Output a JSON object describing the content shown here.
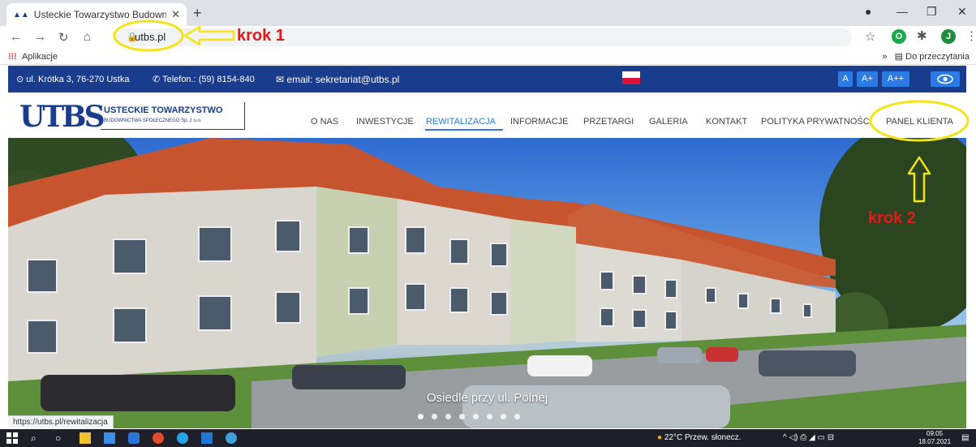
{
  "browser": {
    "tab_title": "Usteckie Towarzystwo Budownict",
    "new_tab": "+",
    "url": "utbs.pl",
    "bookmarks_apps": "Aplikacje",
    "bookmarks_overflow": "»",
    "reading_list": "Do przeczytania",
    "profile_initial": "J",
    "status_url": "https://utbs.pl/rewitalizacja"
  },
  "site": {
    "address": "ul. Krótka 3, 76-270 Ustka",
    "phone": "Telefon.: (59) 8154-840",
    "email_label": "email:",
    "email": "sekretariat@utbs.pl",
    "font_sizes": [
      "A",
      "A+",
      "A++"
    ],
    "logo_mark": "UTBS",
    "logo_name": "USTECKIE TOWARZYSTWO",
    "logo_sub": "BUDOWNICTWA SPOŁECZNEGO Sp. z o.o.",
    "nav": [
      "O NAS",
      "INWESTYCJE",
      "REWITALIZACJA",
      "INFORMACJE",
      "PRZETARGI",
      "GALERIA",
      "KONTAKT",
      "POLITYKA PRYWATNOŚCI",
      "PANEL KLIENTA"
    ],
    "active_nav": "REWITALIZACJA",
    "hero_caption": "Osiedle przy ul. Polnej",
    "slide_count": 8,
    "active_slide": 0
  },
  "annotations": {
    "step1": "krok 1",
    "step2": "krok 2"
  },
  "taskbar": {
    "weather": "22°C  Przew. słonecz.",
    "time": "09:05",
    "date": "18.07.2021"
  },
  "colors": {
    "brand_blue": "#1a3c8c",
    "accent_blue": "#2c7be5",
    "annotation_red": "#e31919",
    "annotation_yellow": "#f5e31a"
  }
}
